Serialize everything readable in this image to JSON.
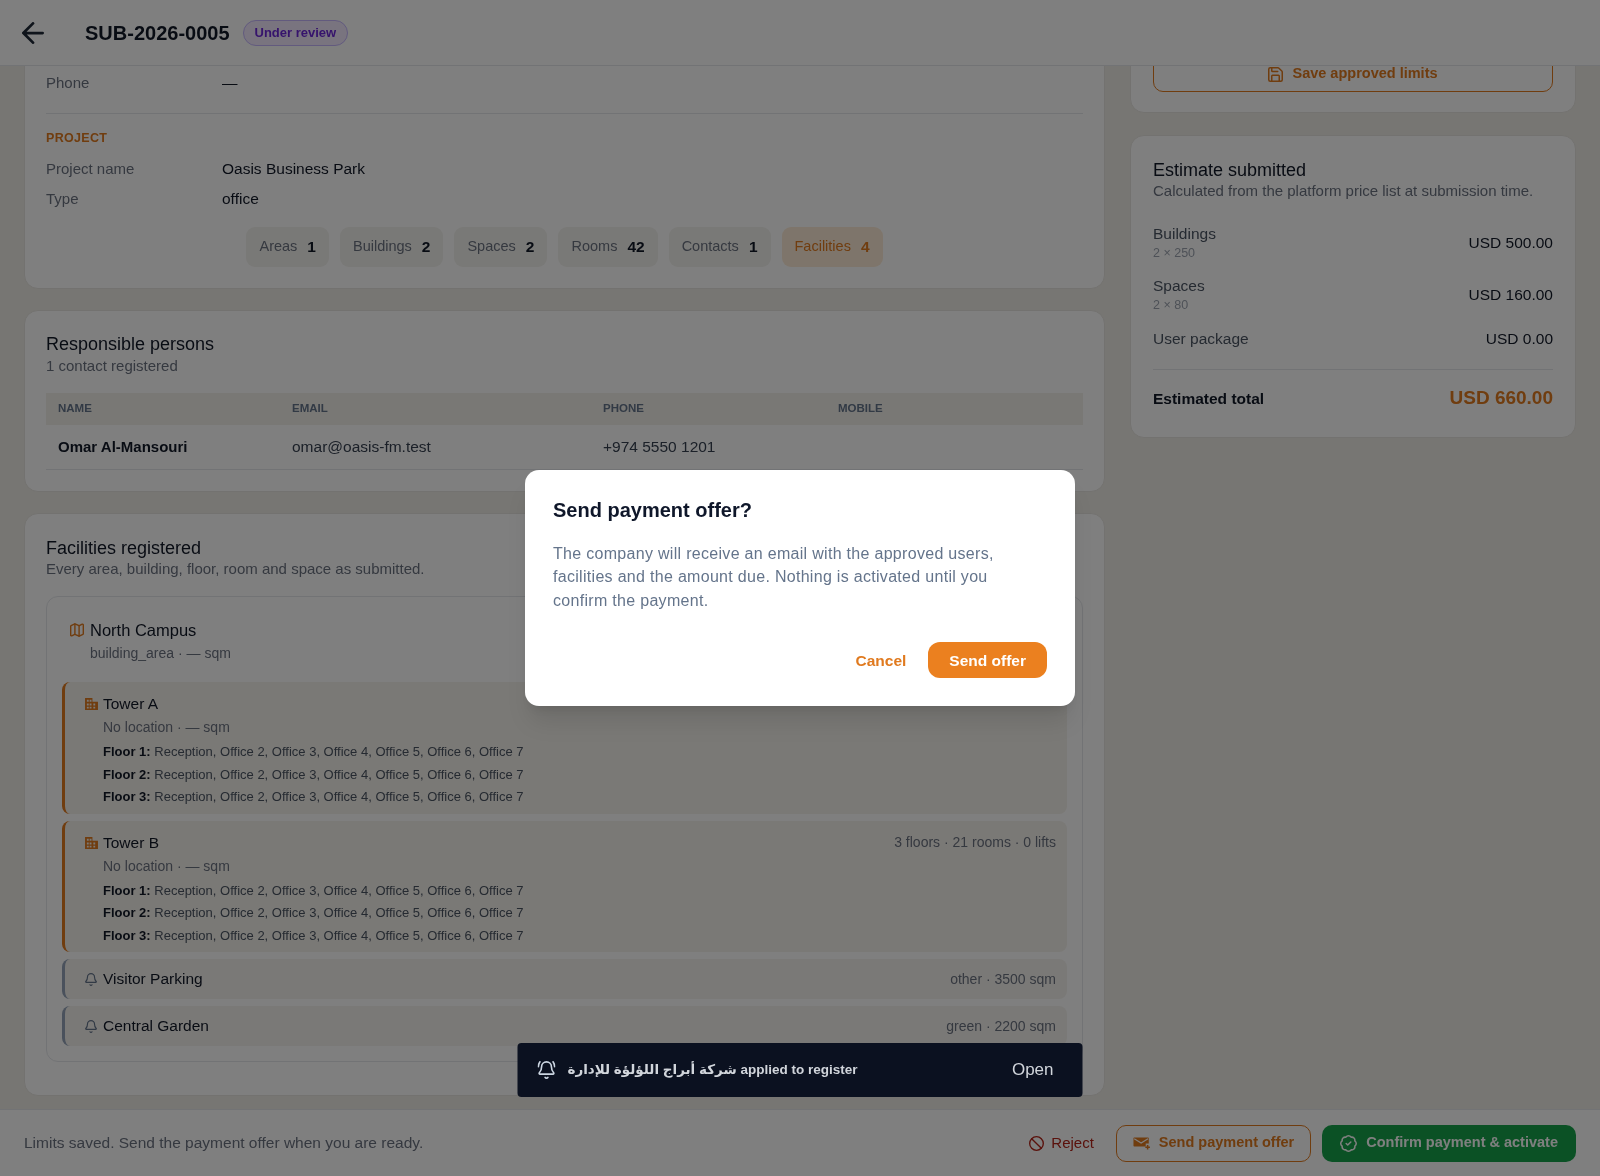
{
  "header": {
    "title": "SUB-2026-0005",
    "status": "Under review"
  },
  "details": {
    "rows": [
      {
        "label": "Phone",
        "value": "—"
      }
    ],
    "section": "PROJECT",
    "project_rows": [
      {
        "label": "Project name",
        "value": "Oasis Business Park"
      },
      {
        "label": "Type",
        "value": "office"
      }
    ],
    "counts": [
      {
        "label": "Areas",
        "count": "1",
        "selected": false
      },
      {
        "label": "Buildings",
        "count": "2",
        "selected": false
      },
      {
        "label": "Spaces",
        "count": "2",
        "selected": false
      },
      {
        "label": "Rooms",
        "count": "42",
        "selected": false
      },
      {
        "label": "Contacts",
        "count": "1",
        "selected": false
      },
      {
        "label": "Facilities",
        "count": "4",
        "selected": true
      }
    ]
  },
  "responsible_persons": {
    "title": "Responsible persons",
    "subtitle": "1 contact registered",
    "columns": [
      "NAME",
      "EMAIL",
      "PHONE",
      "MOBILE"
    ],
    "rows": [
      {
        "name": "Omar Al-Mansouri",
        "email": "omar@oasis-fm.test",
        "phone": "+974 5550 1201"
      }
    ]
  },
  "facilities": {
    "title": "Facilities registered",
    "subtitle": "Every area, building, floor, room and space as submitted.",
    "items": [
      {
        "kind": "area",
        "name": "North Campus",
        "meta": "building_area · — sqm",
        "children": [
          {
            "kind": "building",
            "name": "Tower A",
            "meta": "No location · — sqm",
            "floors": [
              "**Floor 1:** Reception, Office 2, Office 3, Office 4, Office 5, Office 6, Office 7",
              "**Floor 2:** Reception, Office 2, Office 3, Office 4, Office 5, Office 6, Office 7",
              "**Floor 3:** Reception, Office 2, Office 3, Office 4, Office 5, Office 6, Office 7"
            ]
          },
          {
            "kind": "building",
            "name": "Tower B",
            "summary": "3 floors · 21 rooms · 0 lifts",
            "meta": "No location · — sqm",
            "floors": [
              "**Floor 1:** Reception, Office 2, Office 3, Office 4, Office 5, Office 6, Office 7",
              "**Floor 2:** Reception, Office 2, Office 3, Office 4, Office 5, Office 6, Office 7",
              "**Floor 3:** Reception, Office 2, Office 3, Office 4, Office 5, Office 6, Office 7"
            ]
          },
          {
            "kind": "space",
            "name": "Visitor Parking",
            "summary": "other · 3500 sqm"
          },
          {
            "kind": "space",
            "name": "Central Garden",
            "summary": "green · 2200 sqm"
          }
        ]
      }
    ]
  },
  "limits": {
    "save_button": "Save approved limits"
  },
  "estimate": {
    "title": "Estimate submitted",
    "subtitle": "Calculated from the platform price list at submission time.",
    "lines": [
      {
        "label": "Buildings",
        "detail": "2 × 250",
        "amount": "USD 500.00"
      },
      {
        "label": "Spaces",
        "detail": "2 × 80",
        "amount": "USD 160.00"
      },
      {
        "label": "User package",
        "amount": "USD 0.00"
      }
    ],
    "total": {
      "label": "Estimated total",
      "amount": "USD 660.00"
    }
  },
  "footer": {
    "message": "Limits saved. Send the payment offer when you are ready.",
    "actions": [
      {
        "kind": "reject",
        "label": "Reject"
      },
      {
        "kind": "outline",
        "label": "Send payment offer"
      },
      {
        "kind": "confirm",
        "label": "Confirm payment & activate"
      }
    ]
  },
  "dialog": {
    "title": "Send payment offer?",
    "body": "The company will receive an email with the approved users, facilities and the amount due. Nothing is activated until you confirm the payment.",
    "cancel": "Cancel",
    "confirm": "Send offer"
  },
  "toast": {
    "message": "شركة أبراج اللؤلؤة للإدارة applied to register",
    "action": "Open"
  }
}
